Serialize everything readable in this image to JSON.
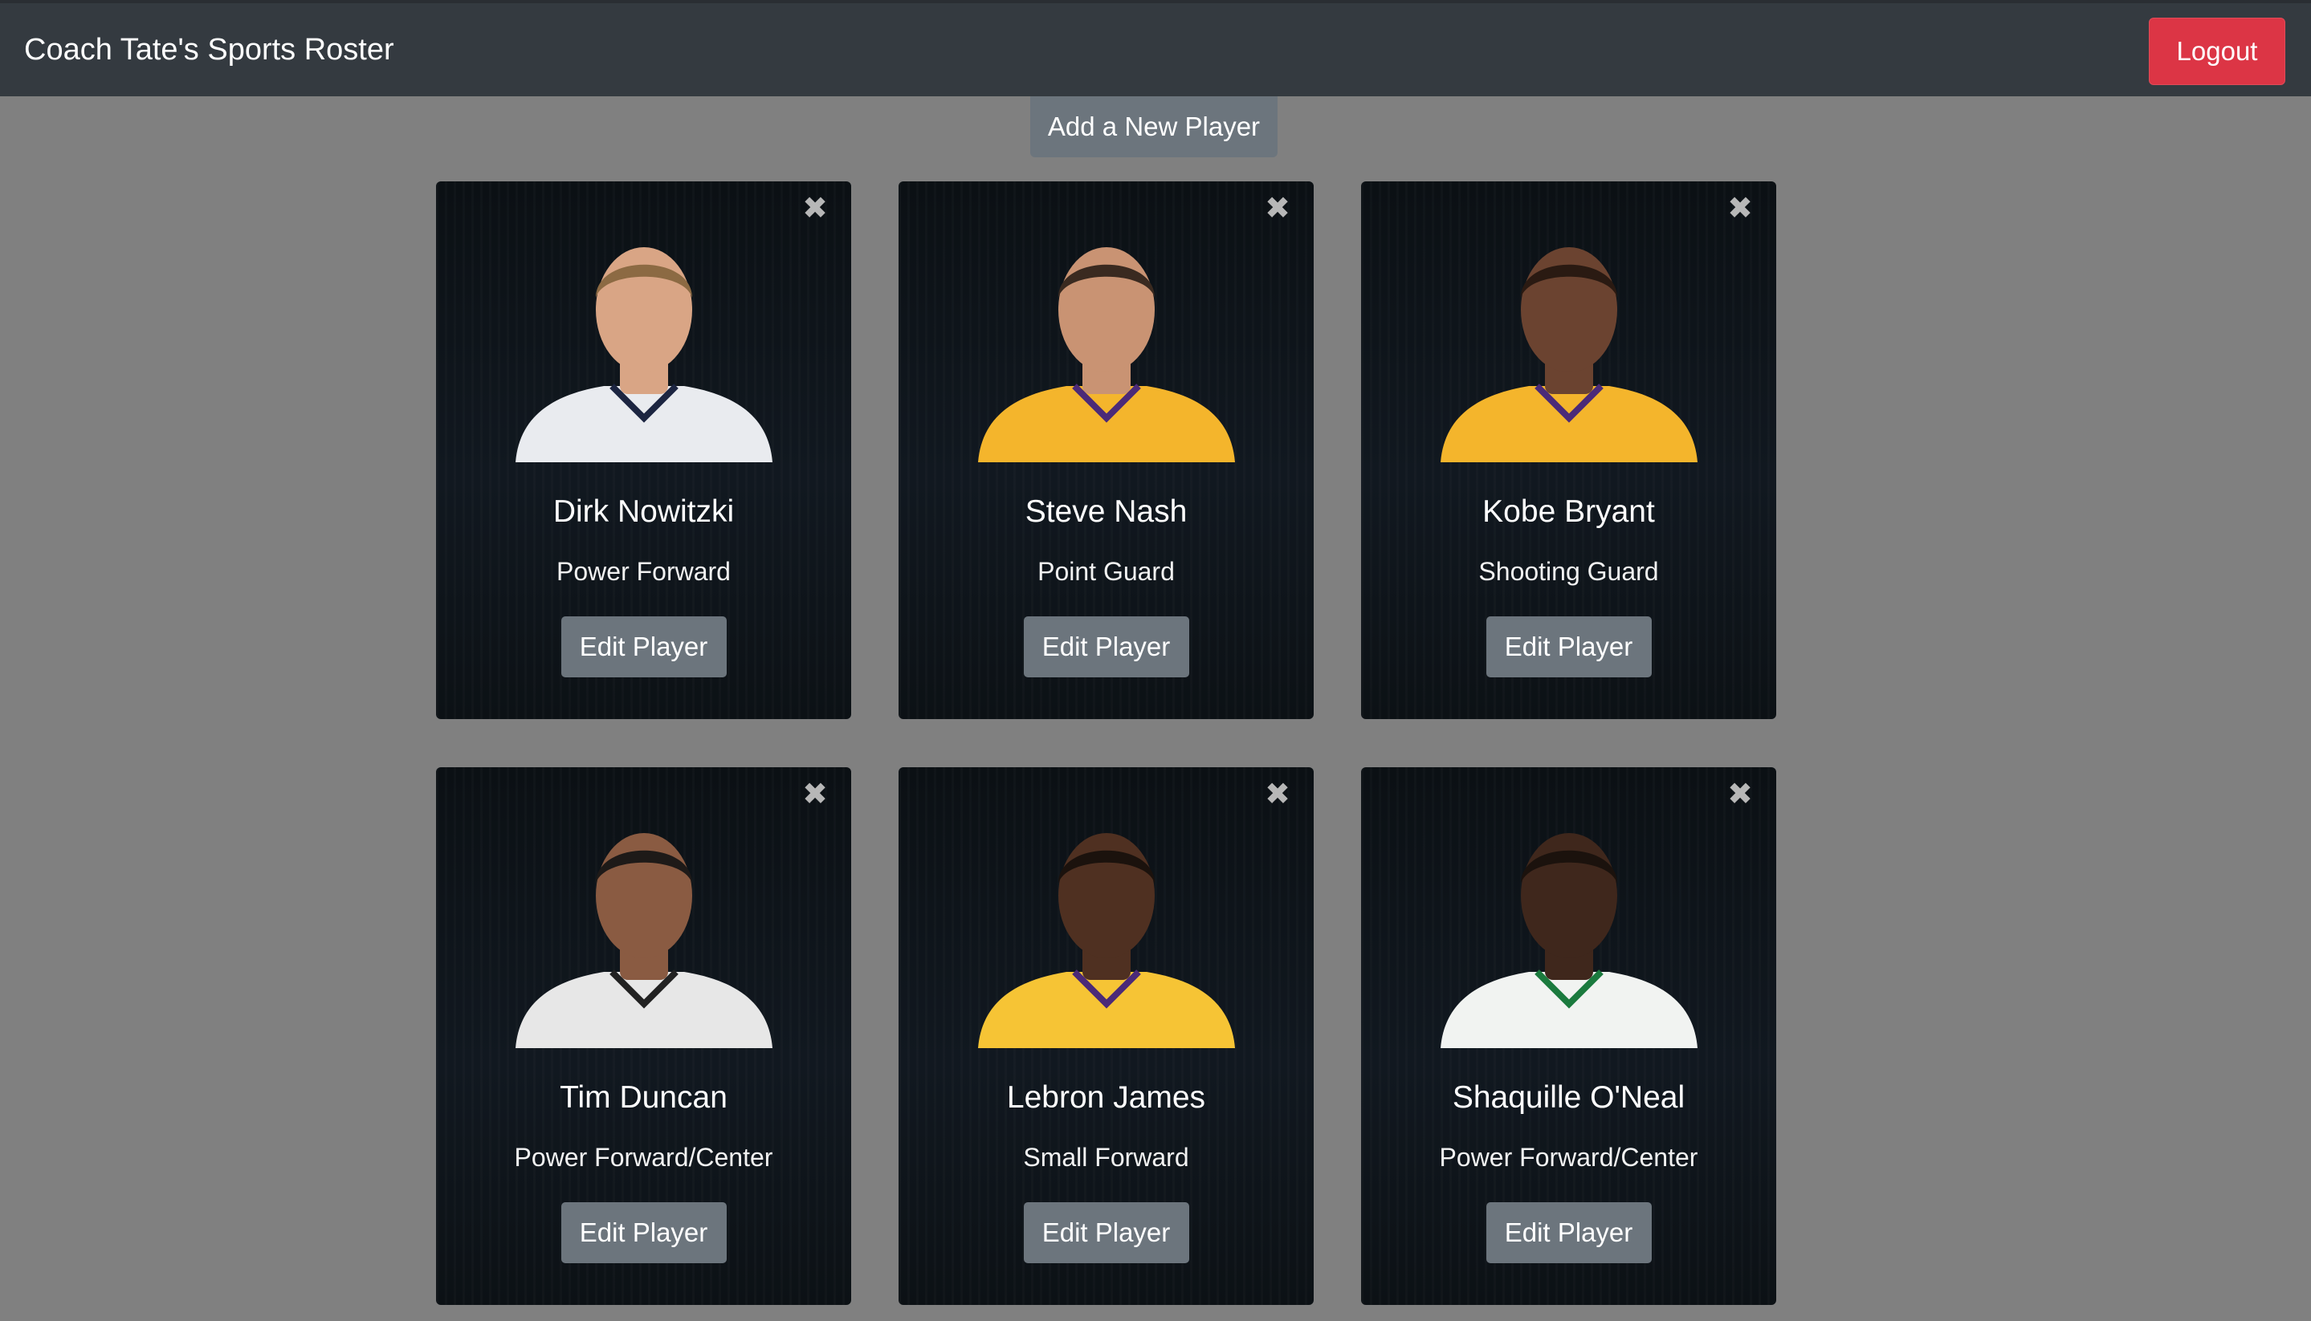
{
  "header": {
    "title": "Coach Tate's Sports Roster",
    "logout_label": "Logout"
  },
  "actions": {
    "add_player_label": "Add a New Player"
  },
  "close_glyph": "✖",
  "edit_label": "Edit Player",
  "players": [
    {
      "name": "Dirk Nowitzki",
      "position": "Power Forward",
      "skin": "#d9a585",
      "hair": "#8c6a43",
      "jersey": "#e9ebef",
      "trim": "#1c2541"
    },
    {
      "name": "Steve Nash",
      "position": "Point Guard",
      "skin": "#c99373",
      "hair": "#3a2a20",
      "jersey": "#f4b52c",
      "trim": "#4b2a78"
    },
    {
      "name": "Kobe Bryant",
      "position": "Shooting Guard",
      "skin": "#6b4330",
      "hair": "#2a1a12",
      "jersey": "#f4b52c",
      "trim": "#4b2a78"
    },
    {
      "name": "Tim Duncan",
      "position": "Power Forward/Center",
      "skin": "#8a5b42",
      "hair": "#1e1a18",
      "jersey": "#e7e7e7",
      "trim": "#222222"
    },
    {
      "name": "Lebron James",
      "position": "Small Forward",
      "skin": "#4f3021",
      "hair": "#1b120d",
      "jersey": "#f6c435",
      "trim": "#4b2a78"
    },
    {
      "name": "Shaquille O'Neal",
      "position": "Power Forward/Center",
      "skin": "#3f271c",
      "hair": "#1b120d",
      "jersey": "#f1f3f1",
      "trim": "#1b7a3e"
    }
  ]
}
